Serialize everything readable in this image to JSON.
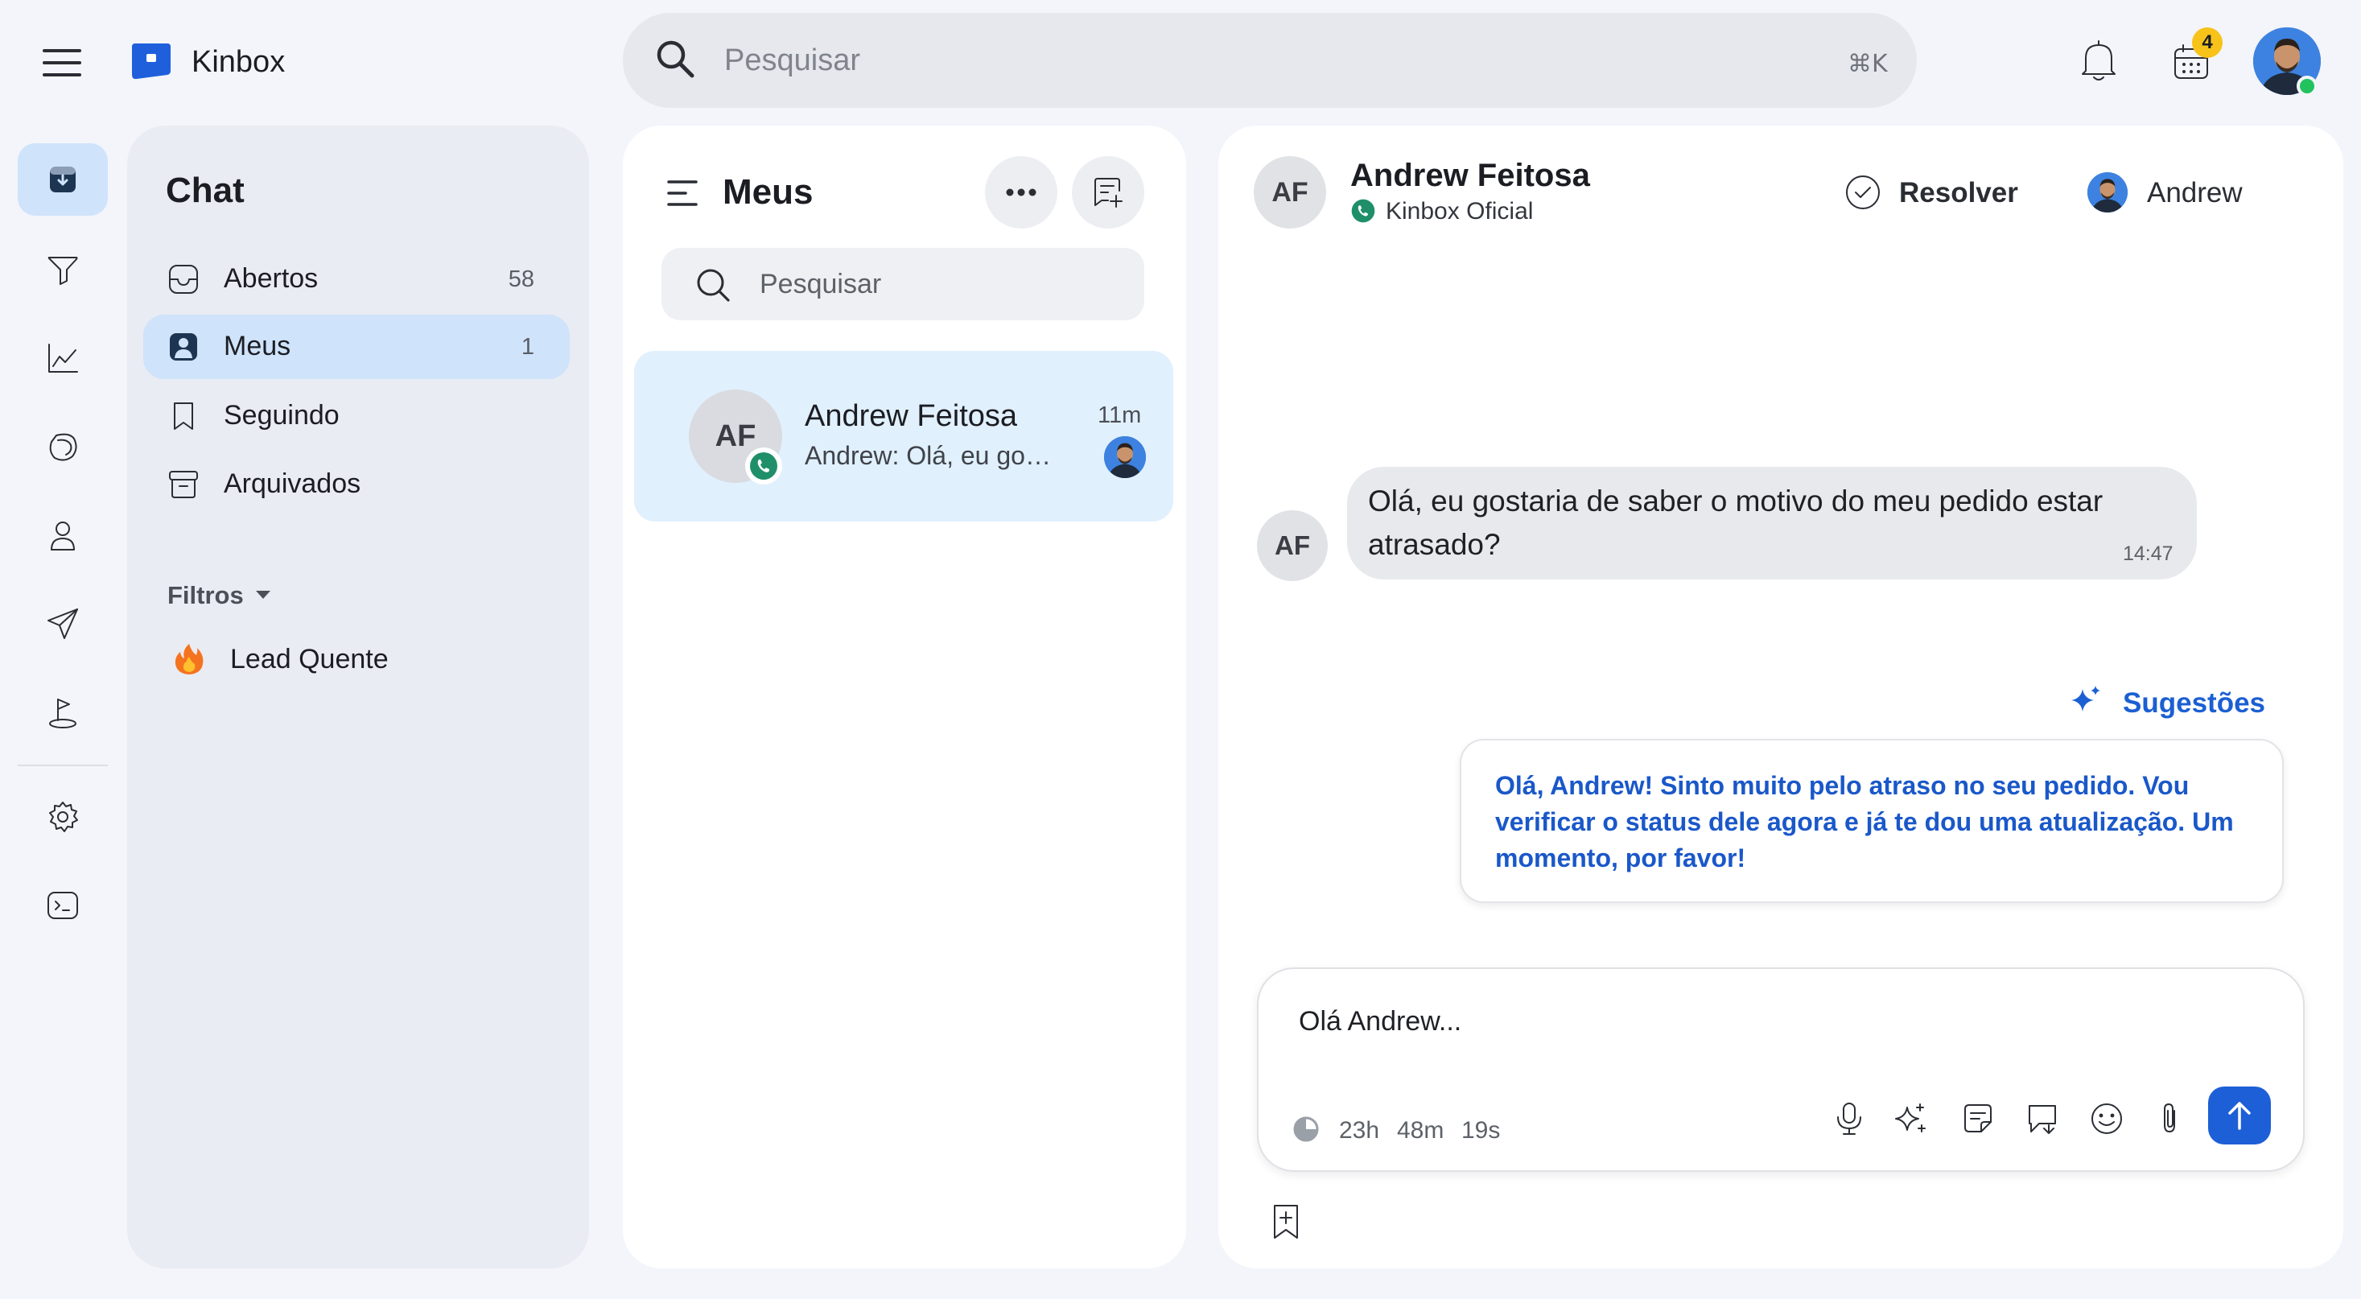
{
  "app": {
    "brand": "Kinbox",
    "search_placeholder": "Pesquisar",
    "search_shortcut": "⌘K",
    "calendar_badge": "4"
  },
  "chat_panel": {
    "title": "Chat",
    "items": [
      {
        "label": "Abertos",
        "count": "58"
      },
      {
        "label": "Meus",
        "count": "1"
      },
      {
        "label": "Seguindo",
        "count": ""
      },
      {
        "label": "Arquivados",
        "count": ""
      }
    ],
    "filters_label": "Filtros",
    "filters": [
      {
        "label": "Lead Quente",
        "icon": "fire-icon"
      }
    ]
  },
  "list_panel": {
    "title": "Meus",
    "search_placeholder": "Pesquisar",
    "conversations": [
      {
        "initials": "AF",
        "name": "Andrew Feitosa",
        "preview": "Andrew: Olá, eu gostaria de saber o motivo do meu pedido estar atrasado?",
        "time": "11m"
      }
    ]
  },
  "conversation": {
    "contact_initials": "AF",
    "contact_name": "Andrew Feitosa",
    "channel": "Kinbox Oficial",
    "resolve_label": "Resolver",
    "assignee": "Andrew",
    "messages": [
      {
        "from_initials": "AF",
        "text": "Olá, eu gostaria de saber o motivo do meu pedido estar atrasado?",
        "time": "14:47"
      }
    ],
    "suggestions_label": "Sugestões",
    "suggestion_text": "Olá, Andrew! Sinto muito pelo atraso no seu pedido. Vou verificar o status dele agora e já te dou uma atualização. Um momento, por favor!",
    "composer_value": "Olá Andrew...",
    "timer": {
      "hours": "23h",
      "minutes": "48m",
      "seconds": "19s"
    }
  },
  "colors": {
    "accent": "#1d5fd6",
    "active_bg": "#cfe3fb",
    "suggestion_text": "#1a58c9",
    "whatsapp": "#1f8f6a",
    "badge": "#f7c31a"
  }
}
